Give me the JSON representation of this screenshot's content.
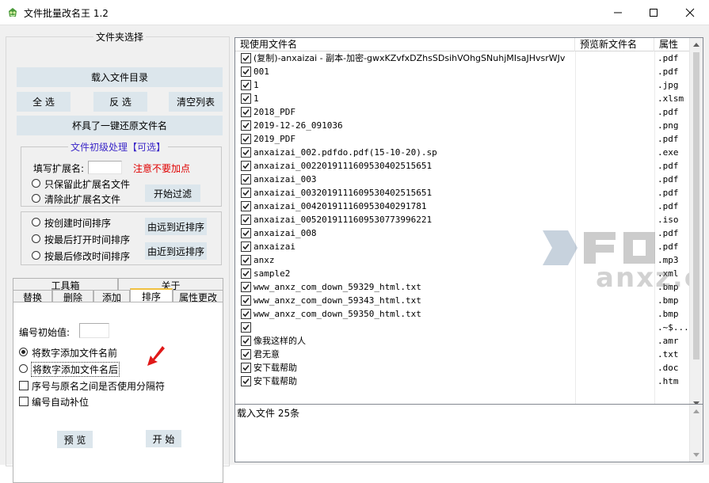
{
  "window": {
    "title": "文件批量改名王  1.2"
  },
  "folder_group": {
    "legend": "文件夹选择",
    "load_button": "载入文件目录",
    "select_all": "全 选",
    "invert": "反 选",
    "clear": "清空列表",
    "restore": "杯具了一键还原文件名"
  },
  "pre_group": {
    "legend": "文件初级处理【可选】",
    "ext_label": "填写扩展名:",
    "ext_value": "",
    "ext_hint": "注意不要加点",
    "keep_only": "只保留此扩展名文件",
    "remove_ext": "清除此扩展名文件",
    "filter_button": "开始过滤"
  },
  "sort_group": {
    "by_created": "按创建时间排序",
    "by_opened": "按最后打开时间排序",
    "by_modified": "按最后修改时间排序",
    "far_to_near": "由远到近排序",
    "near_to_far": "由近到远排序"
  },
  "tabs": {
    "row1": [
      "工具箱",
      "关于"
    ],
    "row2": [
      "替换",
      "删除",
      "添加",
      "排序",
      "属性更改"
    ],
    "active": "排序"
  },
  "sort_panel": {
    "start_label": "编号初始值:",
    "start_value": "",
    "prefix_number": "将数字添加文件名前",
    "suffix_number": "将数字添加文件名后",
    "use_separator": "序号与原名之间是否使用分隔符",
    "auto_pad": "编号自动补位",
    "preview_button": "预 览",
    "start_button": "开 始"
  },
  "file_list": {
    "columns": [
      "现使用文件名",
      "预览新文件名",
      "属性"
    ],
    "rows": [
      {
        "name": "(复制)-anxaizai - 副本-加密-gwxKZvfxDZhsSDsihVOhgSNuhjMIsaJHvsrWJv",
        "preview": "",
        "ext": ".pdf"
      },
      {
        "name": "001",
        "preview": "",
        "ext": ".pdf"
      },
      {
        "name": "1",
        "preview": "",
        "ext": ".jpg"
      },
      {
        "name": "1",
        "preview": "",
        "ext": ".xlsm"
      },
      {
        "name": "2018_PDF",
        "preview": "",
        "ext": ".pdf"
      },
      {
        "name": "2019-12-26_091036",
        "preview": "",
        "ext": ".png"
      },
      {
        "name": "2019_PDF",
        "preview": "",
        "ext": ".pdf"
      },
      {
        "name": "anxaizai_002.pdfdo.pdf(15-10-20).sp",
        "preview": "",
        "ext": ".exe"
      },
      {
        "name": "anxaizai_0022019111609530402515651",
        "preview": "",
        "ext": ".pdf"
      },
      {
        "name": "anxaizai_003",
        "preview": "",
        "ext": ".pdf"
      },
      {
        "name": "anxaizai_0032019111609530402515651",
        "preview": "",
        "ext": ".pdf"
      },
      {
        "name": "anxaizai_004201911160953040291781",
        "preview": "",
        "ext": ".pdf"
      },
      {
        "name": "anxaizai_0052019111609530773996221",
        "preview": "",
        "ext": ".iso"
      },
      {
        "name": "anxaizai_008",
        "preview": "",
        "ext": ".pdf"
      },
      {
        "name": "anxaizai",
        "preview": "",
        "ext": ".pdf"
      },
      {
        "name": "anxz",
        "preview": "",
        "ext": ".mp3"
      },
      {
        "name": "sample2",
        "preview": "",
        "ext": ".xml"
      },
      {
        "name": "www_anxz_com_down_59329_html.txt",
        "preview": "",
        "ext": ".bmp"
      },
      {
        "name": "www_anxz_com_down_59343_html.txt",
        "preview": "",
        "ext": ".bmp"
      },
      {
        "name": "www_anxz_com_down_59350_html.txt",
        "preview": "",
        "ext": ".bmp"
      },
      {
        "name": "",
        "preview": "",
        "ext": ".~$..."
      },
      {
        "name": "像我这样的人",
        "preview": "",
        "ext": ".amr"
      },
      {
        "name": "君无意",
        "preview": "",
        "ext": ".txt"
      },
      {
        "name": "安下载帮助",
        "preview": "",
        "ext": ".doc"
      },
      {
        "name": "安下载帮助",
        "preview": "",
        "ext": ".htm"
      }
    ]
  },
  "log": {
    "text": "载入文件  25条"
  },
  "watermark": {
    "text": "anxz.com"
  },
  "colors": {
    "hint_red": "#e00000",
    "legend_blue": "#3c28c8",
    "button_bg": "#dce6ec"
  },
  "icons": {
    "app": "app-icon",
    "min": "minimize-icon",
    "max": "maximize-icon",
    "close": "close-icon",
    "pointer": "red-arrow-icon"
  }
}
